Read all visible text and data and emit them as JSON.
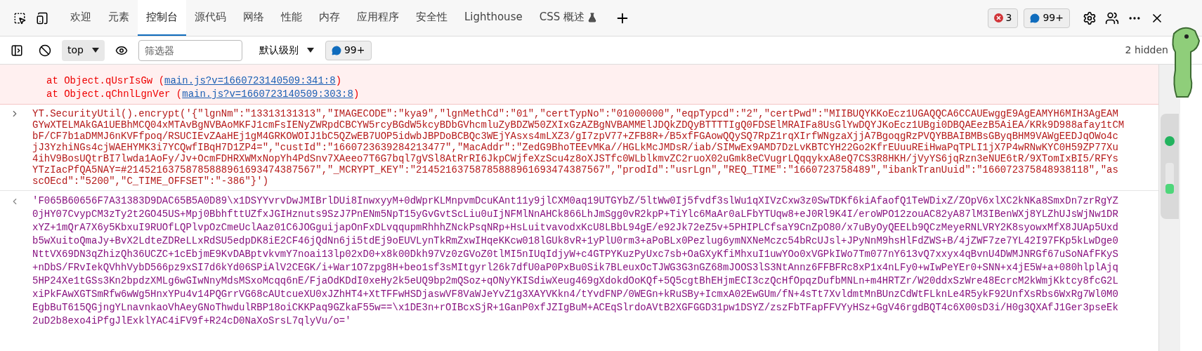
{
  "tabs": [
    {
      "label": "欢迎",
      "selected": false,
      "kind": "plain"
    },
    {
      "label": "元素",
      "selected": false,
      "kind": "plain"
    },
    {
      "label": "控制台",
      "selected": true,
      "kind": "plain"
    },
    {
      "label": "源代码",
      "selected": false,
      "kind": "plain"
    },
    {
      "label": "网络",
      "selected": false,
      "kind": "plain"
    },
    {
      "label": "性能",
      "selected": false,
      "kind": "plain"
    },
    {
      "label": "内存",
      "selected": false,
      "kind": "plain"
    },
    {
      "label": "应用程序",
      "selected": false,
      "kind": "plain"
    },
    {
      "label": "安全性",
      "selected": false,
      "kind": "plain"
    },
    {
      "label": "Lighthouse",
      "selected": false,
      "kind": "plain"
    },
    {
      "label": "CSS 概述",
      "selected": false,
      "kind": "experimental"
    }
  ],
  "counters": {
    "errors": "3",
    "messages": "99+"
  },
  "toolbar": {
    "context": "top",
    "filter_placeholder": "筛选器",
    "level": "默认级别",
    "issues": "99+",
    "hidden": "2 hidden"
  },
  "console": {
    "stack": [
      {
        "text": "at Object.qUsrIsGw (",
        "link": "main.js?v=1660723140509:341:8",
        "close": ")"
      },
      {
        "text": "at Object.qChnlLgnVer (",
        "link": "main.js?v=1660723140509:303:8",
        "close": ")"
      }
    ],
    "input_lines": [
      "YT.SecurityUtil().encrypt('{\"lgnNm\":\"13313131313\",\"IMAGECODE\":\"kya9\",\"lgnMethCd\":\"01\",\"certTypNo\":\"01000000\",\"eqpTypcd\":\"2\",\"certPwd\":\"MIIBUQYKKoEcz1UGAQQCA6CCAUEwggE9AgEAMYH6MIH3AgEAM",
      "GYwXTELMAkGA1UEBhMCQ04xMTAvBgNVBAoMKFJ1cmFsIENyZWRpdCBCYW5rcyBGdW5kcyBDbGVhcmluZyBDZW50ZXIxGzAZBgNVBAMMElJDQkZDQyBTTTTIgQ0FDSElMRAIFa8UsGlYwDQYJKoEcz1UBgi0DBQAEezB5AiEA/KRk9D988afay1tCM",
      "bF/CF7b1aDMMJ6nKVFfpoq/RSUCIEvZAaHEj1gM4GRKOWOIJ1bC5QZwEB7UOP5idwbJBPDoBCBQc3WEjYAsxs4mLXZ3/gI7zpV77+ZFB8R+/B5xfFGAowQQySQ7RpZ1rqXIrfWNgzaXjjA7BgoqgRzPVQYBBAIBMBsGByqBHM9VAWgEEDJqOWo4c",
      "jJ3YzhiNGs4cjWAEHYMK3i7YCQwfIBqH7D1ZP4=\",\"custId\":\"1660723639284213477\",\"MacAddr\":\"ZedG9BhoTEEvMKa//HGLkMcJMDsR/iab/SIMwEx9AMD7DzLvKBTCYH22Go2KfrEUuuREiHwaPqTPLI1jX7P4wRNwKYC0H59ZP77Xu",
      "4ihV9BosUQtrBI7lwda1AoFy/Jv+OcmFDHRXWMxNopYh4PdSnv7XAeeo7T6G7bql7gVSl8AtRrRI6JkpCWjfeXzScu4z8oXJSTfc0WLblkmvZC2ruoX02uGmk8eCVugrLQqqykxA8eQ7CS3R8HKH/jVyYS6jqRzn3eNUE6tR/9XTomIxBI5/RFYs",
      "YTzIacPfQA5NAY=#21452163758785888961693474387567\",\"_MCRYPT_KEY\":\"21452163758785888961693474387567\",\"prodId\":\"usrLgn\",\"REQ_TIME\":\"1660723758489\",\"ibankTranUuid\":\"166072375848938118\",\"as",
      "scOEcd\":\"5200\",\"C_TIME_OFFSET\":\"-386\"}')"
    ],
    "output_lines": [
      "'F065B60656F7A31383D9DAC65B5A0D89\\x1DSYYvrvDwJMIBrlDUi8InwxyyM+0dWprKLMnpvmDcuKAnt11y9jlCXM0aq19UTGYbZ/5ltWw0Ij5fvdf3slWu1qXIVzCxw3z0SwTDKf6kiAfaofQ1TeWDixZ/ZOpV6xlXC2kNKa8SmxDn7zrRgYZ",
      "0jHY07CvypCM3zTy2t2GO45US+Mpj0BbhfttUZfxJGIHznuts9SzJ7PnENm5NpT15yGvGvtScLiu0uIjNFMlNnAHCk866LhJmSgg0vR2kpP+TiYlc6MaAr0aLFbYTUqw8+eJ0Rl9K4I/eroWPO12zouAC82yA87lM3IBenWXj8YLZhUJsWjNw1DR",
      "xYZ+1mQrA7X6y5KbxuI9RUOfLQPlvpOzCmeUclAaz01C6JOGguijapOnFxDLvqqupmRhhhZNckPsqNRp+HsLuitvavodxKcU8LBbL94gE/e92Jk72eZ5v+5PHIPLCfsaY9CnZpO80/x7uByOyQEELb9QCzMeyeRNLVRY2K8syowxMfX8JUAp5Uxd",
      "b5wXuitoQmaJy+BvX2LdteZDReLLxRdSU5edpDK8iE2CF46jQdNn6ji5tdEj9oEUVLynTkRmZxwIHqeKKcw018lGUk8vR+1yPlU0rm3+aPoBLx0Pezlug6ymNXNeMczc54bRcUJsl+JPyNnM9hsHlFdZWS+B/4jZWF7ze7YL42I97FKp5kLwDge0",
      "NttVX69DN3qZhizQh36UCZC+1cEbjmE9KvDABptvkvmY7noai13lp02xD0+x8k00Dkh97Vz0zGVoZ0tlMI5nIUqIdjyW+c4GTPYKuzPyUxc7sb+OaGXyKfiMhxuI1uwYOo0xVGPkIWo7Tm077nY613vQ7xxyx4qBvnU4DWMJNRGf67uSoNAfFKyS",
      "+nDbS/FRvIekQVhhVybD566pz9xSI7d6kYd06SPiAlV2CEGK/i+War1O7zpg8H+beo1sf3sMItgyrl26k7dfU0aP0PxBu0Sik7BLeuxOcTJWG3G3nGZ68mJOOS3lS3NtAnnz6FFBFRc8xP1x4nLFy0+wIwPeYEr0+SNN+x4jE5W+a+080hlplAjq",
      "5HP24Xe1tGSs3Kn2bpdzXMLg6wGIwNnyMdsMSxoMcqq6nE/FjaOdKDdI0xeHy2k5eUQ9bp2mQSoz+qONyYKISdiwXeug469gXdokdOoKQf+5Q5cgtBhEHjmECI3czQcHfOpqzDufbMNLn+m4HRTZr/W20ddxSzWre48EcrcM2kWmjKktcy8fcG2L",
      "xiPkFAwXGTSmRfw6wWg5HnxYPu4v14PQGrrVG68cAUtcueXU0xJZhHT4+XtTFFwHSDjaswVF8VaWJeYvZ1g3XAYVKkn4/tYvdFNP/0WEGn+kRuSBy+IcmxA02EwGUm/fN+4sTt7XvldmtMnBUnzCdWtFLknLe4R5ykF92UnfXsRbs6WxRg7Wl0M0",
      "EgbBuT615QGjngYLnavnkaoVhAeyGNoThwdulRBP18oiCKKPaq9GZkaF55w==\\x1DE3n+rOIBcxSjR+1GanP0xfJZIgBuM+ACEqSlrdoAVtB2XGFGGD31pw1DSYZ/zszFbTFapFFVYyHSz+GgV46rgdBQT4c6X00sD3i/H0g3QXAfJ1Ger3pseEk",
      "2uD2b8exo4iPfgJlExklYAC4iFV9f+R24cD0NaXoSrsL7qlyVu/o='"
    ]
  }
}
